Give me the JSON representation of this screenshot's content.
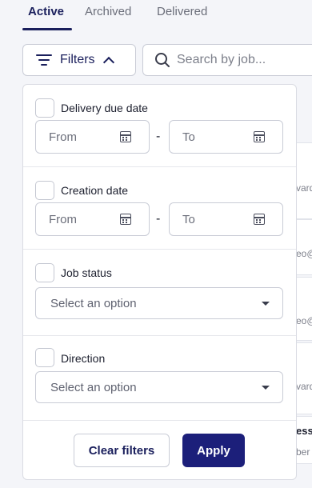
{
  "tabs": [
    {
      "label": "Active",
      "active": true
    },
    {
      "label": "Archived",
      "active": false
    },
    {
      "label": "Delivered",
      "active": false
    }
  ],
  "toolbar": {
    "filters_label": "Filters",
    "search_placeholder": "Search by job..."
  },
  "filters": {
    "delivery": {
      "label": "Delivery due date",
      "from": "From",
      "to": "To",
      "separator": "-"
    },
    "creation": {
      "label": "Creation date",
      "from": "From",
      "to": "To",
      "separator": "-"
    },
    "job_status": {
      "label": "Job status",
      "placeholder": "Select an option"
    },
    "direction": {
      "label": "Direction",
      "placeholder": "Select an option"
    },
    "clear_label": "Clear filters",
    "apply_label": "Apply"
  },
  "background_fragments": [
    "vard",
    "eo@",
    "eo@",
    "vard",
    "ess",
    "ber"
  ],
  "colors": {
    "accent": "#1c1f7a",
    "tab_active": "#1a1f5c"
  }
}
